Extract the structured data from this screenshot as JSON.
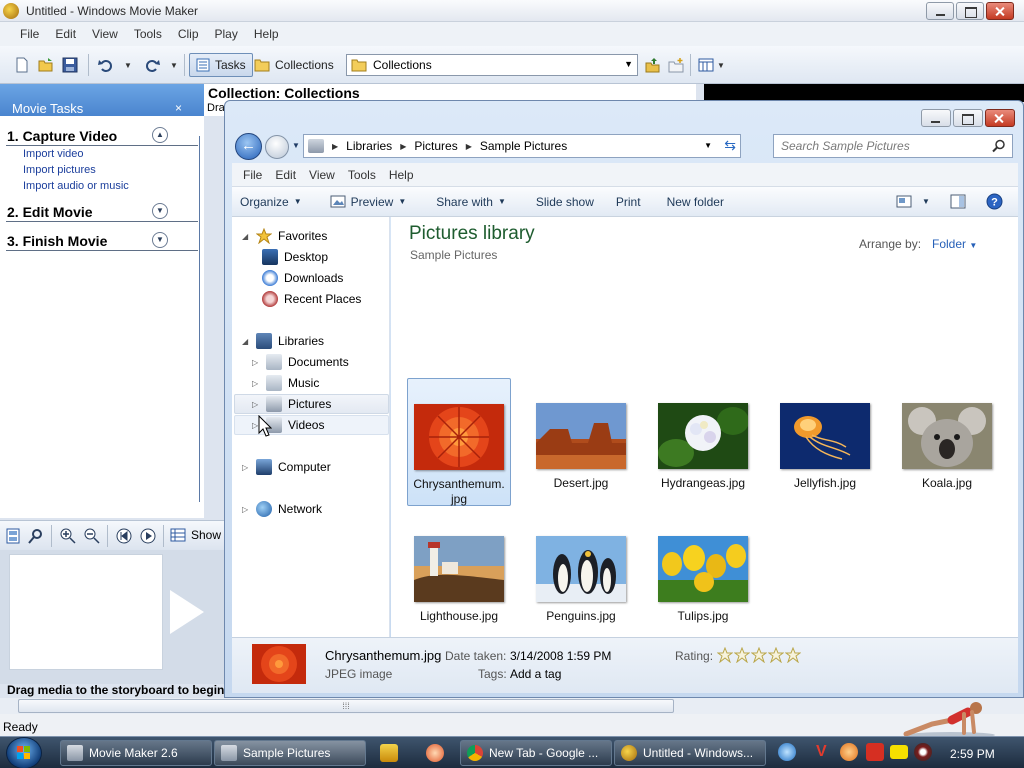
{
  "movie_maker": {
    "title": "Untitled - Windows Movie Maker",
    "menu": [
      "File",
      "Edit",
      "View",
      "Tools",
      "Clip",
      "Play",
      "Help"
    ],
    "toolbar": {
      "tasks_label": "Tasks",
      "collections_label": "Collections",
      "collections_select_value": "Collections"
    },
    "tasks_pane": {
      "title": "Movie Tasks",
      "close_glyph": "×",
      "groups": [
        {
          "title": "1. Capture Video",
          "links": [
            "Import video",
            "Import pictures",
            "Import audio or music"
          ]
        },
        {
          "title": "2. Edit Movie",
          "links": []
        },
        {
          "title": "3. Finish Movie",
          "links": []
        }
      ]
    },
    "collection_title": "Collection: Collections",
    "collection_sub": "Drag",
    "storyboard_show_label": "Show",
    "storyboard_hint": "Drag media to the storyboard to begin",
    "status": "Ready"
  },
  "explorer": {
    "address": [
      "Libraries",
      "Pictures",
      "Sample Pictures"
    ],
    "search_placeholder": "Search Sample Pictures",
    "menu": [
      "File",
      "Edit",
      "View",
      "Tools",
      "Help"
    ],
    "toolbar": {
      "organize": "Organize",
      "preview": "Preview",
      "share_with": "Share with",
      "slide_show": "Slide show",
      "print": "Print",
      "new_folder": "New folder"
    },
    "nav": {
      "favorites": "Favorites",
      "desktop": "Desktop",
      "downloads": "Downloads",
      "recent_places": "Recent Places",
      "libraries": "Libraries",
      "documents": "Documents",
      "music": "Music",
      "pictures": "Pictures",
      "videos": "Videos",
      "computer": "Computer",
      "network": "Network"
    },
    "library_title": "Pictures library",
    "library_subtitle": "Sample Pictures",
    "arrange_by_label": "Arrange by:",
    "arrange_by_value": "Folder",
    "files": [
      {
        "name": "Chrysanthemum.jpg",
        "line1": "Chrysanthemum.",
        "line2": "jpg"
      },
      {
        "name": "Desert.jpg"
      },
      {
        "name": "Hydrangeas.jpg"
      },
      {
        "name": "Jellyfish.jpg"
      },
      {
        "name": "Koala.jpg"
      },
      {
        "name": "Lighthouse.jpg"
      },
      {
        "name": "Penguins.jpg"
      },
      {
        "name": "Tulips.jpg"
      }
    ],
    "details": {
      "filename": "Chrysanthemum.jpg",
      "type": "JPEG image",
      "date_label": "Date taken:",
      "date_value": "3/14/2008 1:59 PM",
      "tags_label": "Tags:",
      "tags_value": "Add a tag",
      "rating_label": "Rating:",
      "rating_stars": 0
    }
  },
  "taskbar": {
    "buttons": [
      "Movie Maker 2.6",
      "Sample Pictures",
      "New Tab - Google ...",
      "Untitled - Windows..."
    ],
    "clock": "2:59 PM"
  },
  "colors": {
    "selection_blue": "#cde2f8",
    "library_title_green": "#1e5c2f",
    "link_blue": "#1b3e9c"
  }
}
